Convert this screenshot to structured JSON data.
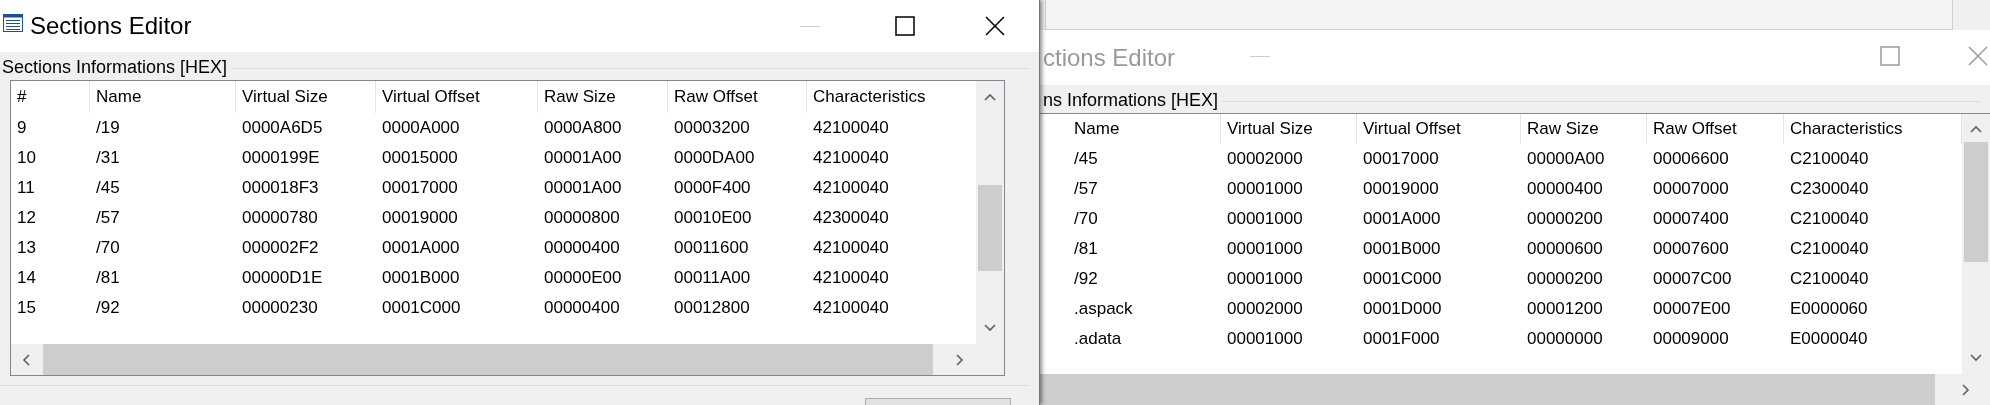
{
  "windows": [
    {
      "title": "Sections Editor",
      "active": true,
      "group": "Sections Informations [HEX]",
      "table": {
        "columns": [
          "#",
          "Name",
          "Virtual Size",
          "Virtual Offset",
          "Raw Size",
          "Raw Offset",
          "Characteristics"
        ],
        "rows": [
          [
            "9",
            "/19",
            "0000A6D5",
            "0000A000",
            "0000A800",
            "00003200",
            "42100040"
          ],
          [
            "10",
            "/31",
            "0000199E",
            "00015000",
            "00001A00",
            "0000DA00",
            "42100040"
          ],
          [
            "11",
            "/45",
            "000018F3",
            "00017000",
            "00001A00",
            "0000F400",
            "42100040"
          ],
          [
            "12",
            "/57",
            "00000780",
            "00019000",
            "00000800",
            "00010E00",
            "42300040"
          ],
          [
            "13",
            "/70",
            "000002F2",
            "0001A000",
            "00000400",
            "00011600",
            "42100040"
          ],
          [
            "14",
            "/81",
            "00000D1E",
            "0001B000",
            "00000E00",
            "00011A00",
            "42100040"
          ],
          [
            "15",
            "/92",
            "00000230",
            "0001C000",
            "00000400",
            "00012800",
            "42100040"
          ]
        ]
      }
    },
    {
      "title": "ctions Editor",
      "active": false,
      "group": "ns Informations [HEX]",
      "table": {
        "columns": [
          "Name",
          "Virtual Size",
          "Virtual Offset",
          "Raw Size",
          "Raw Offset",
          "Characteristics"
        ],
        "rows": [
          [
            "/45",
            "00002000",
            "00017000",
            "00000A00",
            "00006600",
            "C2100040"
          ],
          [
            "/57",
            "00001000",
            "00019000",
            "00000400",
            "00007000",
            "C2300040"
          ],
          [
            "/70",
            "00001000",
            "0001A000",
            "00000200",
            "00007400",
            "C2100040"
          ],
          [
            "/81",
            "00001000",
            "0001B000",
            "00000600",
            "00007600",
            "C2100040"
          ],
          [
            "/92",
            "00001000",
            "0001C000",
            "00000200",
            "00007C00",
            "C2100040"
          ],
          [
            ".aspack",
            "00002000",
            "0001D000",
            "00001200",
            "00007E00",
            "E0000060"
          ],
          [
            ".adata",
            "00001000",
            "0001F000",
            "00000000",
            "00009000",
            "E0000040"
          ]
        ]
      }
    }
  ]
}
